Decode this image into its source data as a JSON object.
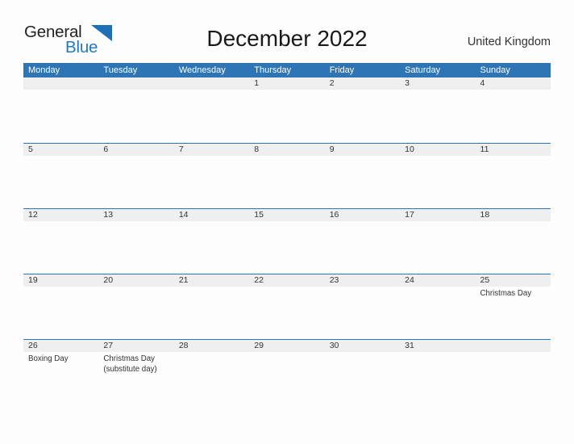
{
  "header": {
    "logo": {
      "word1": "General",
      "word2": "Blue",
      "flag_icon": "triangle-flag-icon"
    },
    "title": "December 2022",
    "country": "United Kingdom"
  },
  "calendar": {
    "weekdays": [
      "Monday",
      "Tuesday",
      "Wednesday",
      "Thursday",
      "Friday",
      "Saturday",
      "Sunday"
    ],
    "colors": {
      "header_blue": "#2e75b6",
      "day_band_gray": "#efefef",
      "logo_blue": "#2277c8",
      "text": "#333333"
    },
    "weeks": [
      {
        "days": [
          {
            "num": "",
            "events": []
          },
          {
            "num": "",
            "events": []
          },
          {
            "num": "",
            "events": []
          },
          {
            "num": "1",
            "events": []
          },
          {
            "num": "2",
            "events": []
          },
          {
            "num": "3",
            "events": []
          },
          {
            "num": "4",
            "events": []
          }
        ]
      },
      {
        "days": [
          {
            "num": "5",
            "events": []
          },
          {
            "num": "6",
            "events": []
          },
          {
            "num": "7",
            "events": []
          },
          {
            "num": "8",
            "events": []
          },
          {
            "num": "9",
            "events": []
          },
          {
            "num": "10",
            "events": []
          },
          {
            "num": "11",
            "events": []
          }
        ]
      },
      {
        "days": [
          {
            "num": "12",
            "events": []
          },
          {
            "num": "13",
            "events": []
          },
          {
            "num": "14",
            "events": []
          },
          {
            "num": "15",
            "events": []
          },
          {
            "num": "16",
            "events": []
          },
          {
            "num": "17",
            "events": []
          },
          {
            "num": "18",
            "events": []
          }
        ]
      },
      {
        "days": [
          {
            "num": "19",
            "events": []
          },
          {
            "num": "20",
            "events": []
          },
          {
            "num": "21",
            "events": []
          },
          {
            "num": "22",
            "events": []
          },
          {
            "num": "23",
            "events": []
          },
          {
            "num": "24",
            "events": []
          },
          {
            "num": "25",
            "events": [
              "Christmas Day"
            ]
          }
        ]
      },
      {
        "days": [
          {
            "num": "26",
            "events": [
              "Boxing Day"
            ]
          },
          {
            "num": "27",
            "events": [
              "Christmas Day",
              "(substitute day)"
            ]
          },
          {
            "num": "28",
            "events": []
          },
          {
            "num": "29",
            "events": []
          },
          {
            "num": "30",
            "events": []
          },
          {
            "num": "31",
            "events": []
          },
          {
            "num": "",
            "events": []
          }
        ]
      }
    ]
  }
}
